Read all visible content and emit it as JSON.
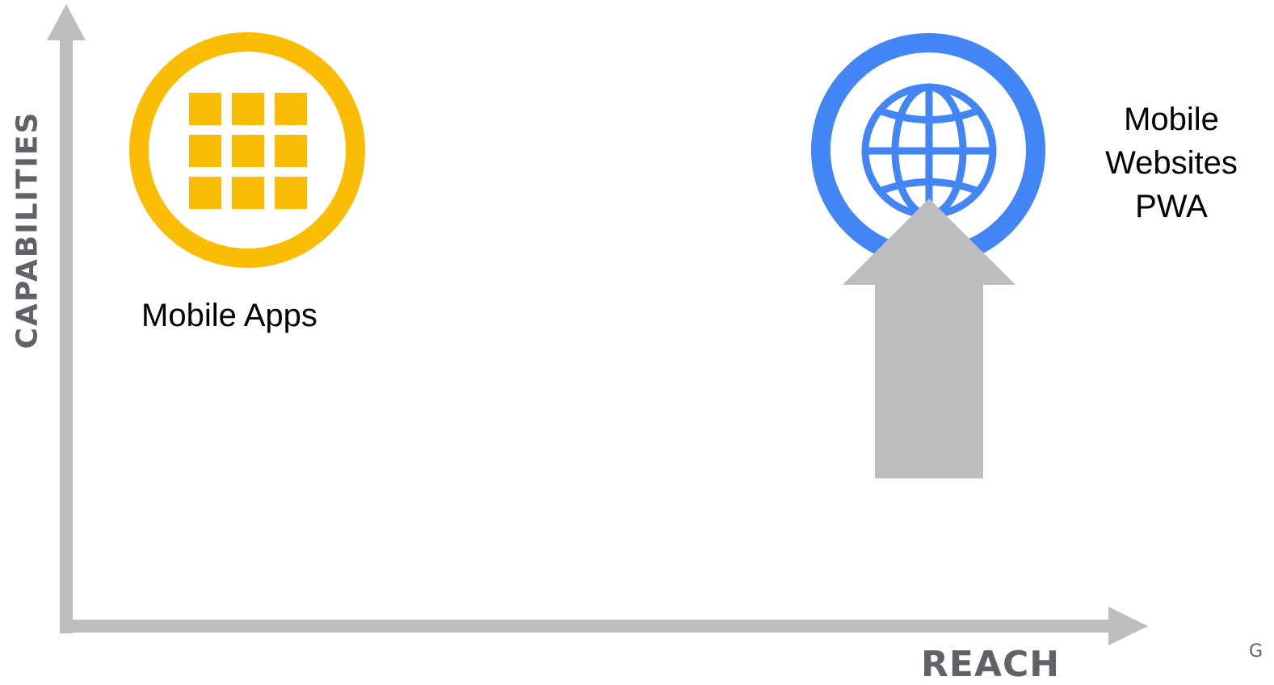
{
  "axes": {
    "y_label": "CAPABILITIES",
    "x_label": "REACH"
  },
  "nodes": {
    "mobile_apps": {
      "label": "Mobile Apps",
      "icon": "app-grid-icon",
      "color": "#FBBC04"
    },
    "mobile_websites": {
      "label_lines": [
        "Mobile",
        "Websites",
        "PWA"
      ],
      "icon": "globe-icon",
      "color": "#4285F4"
    }
  },
  "upward_arrow": {
    "icon": "up-arrow-icon",
    "color": "#BDBDBD"
  },
  "axis_color": "#BDBDBD",
  "corner_mark": "G"
}
